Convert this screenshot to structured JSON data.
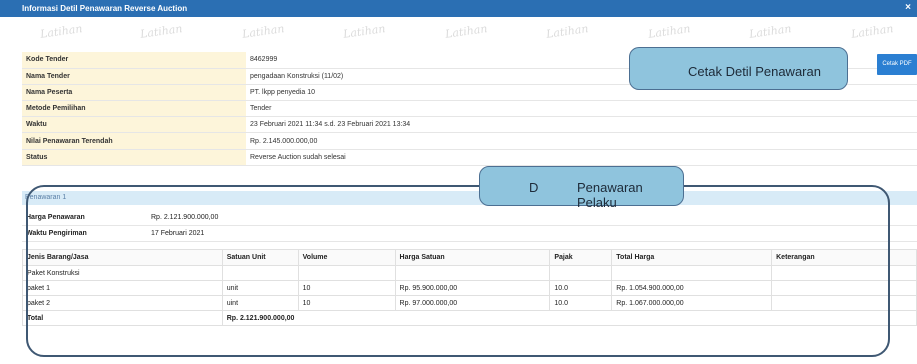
{
  "window": {
    "title": "Informasi Detil Penawaran Reverse Auction",
    "close_icon": "×"
  },
  "watermark": {
    "text": "Latihan"
  },
  "info": [
    {
      "label": "Kode Tender",
      "value": "8462999"
    },
    {
      "label": "Nama Tender",
      "value": "pengadaan Konstruksi (11/02)"
    },
    {
      "label": "Nama Peserta",
      "value": "PT. lkpp penyedia 10"
    },
    {
      "label": "Metode Pemilihan",
      "value": "Tender"
    },
    {
      "label": "Waktu",
      "value": "23 Februari 2021 11:34 s.d. 23 Februari 2021 13:34"
    },
    {
      "label": "Nilai Penawaran Terendah",
      "value": "Rp. 2.145.000.000,00"
    },
    {
      "label": "Status",
      "value": "Reverse Auction sudah selesai"
    }
  ],
  "buttons": {
    "cetak_pdf": "Cetak PDF"
  },
  "callouts": {
    "cetak": "Cetak Detil Penawaran",
    "penawaran_d": "D",
    "penawaran": "Penawaran Pelaku"
  },
  "penawaran": {
    "heading": "Penawaran 1",
    "meta": [
      {
        "label": "Harga Penawaran",
        "value": "Rp. 2.121.900.000,00"
      },
      {
        "label": "Waktu Pengiriman",
        "value": "17 Februari 2021"
      }
    ],
    "columns": [
      "Jenis Barang/Jasa",
      "Satuan Unit",
      "Volume",
      "Harga Satuan",
      "Pajak",
      "Total Harga",
      "Keterangan"
    ],
    "group_label": "Paket Konstruksi",
    "rows": [
      [
        "paket 1",
        "unit",
        "10",
        "Rp. 95.900.000,00",
        "10.0",
        "Rp. 1.054.900.000,00",
        ""
      ],
      [
        "paket 2",
        "uint",
        "10",
        "Rp. 97.000.000,00",
        "10.0",
        "Rp. 1.067.000.000,00",
        ""
      ]
    ],
    "total_label": "Total",
    "total_value": "Rp. 2.121.900.000,00"
  },
  "colors": {
    "titlebar": "#2b6fb3",
    "label_bg": "#fdf5da",
    "section_bg": "#d8ebf7",
    "callout": "#8fc4dd",
    "button": "#2b7fd2"
  }
}
